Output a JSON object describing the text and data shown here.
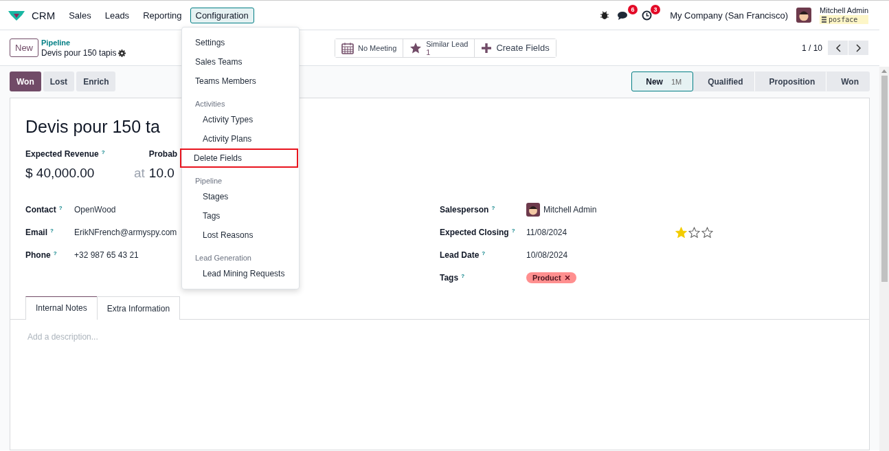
{
  "navbar": {
    "app": "CRM",
    "menus": [
      {
        "label": "Sales",
        "selected": false
      },
      {
        "label": "Leads",
        "selected": false
      },
      {
        "label": "Reporting",
        "selected": false
      },
      {
        "label": "Configuration",
        "selected": true
      }
    ],
    "messages_badge": "6",
    "activities_badge": "3",
    "company": "My Company (San Francisco)",
    "user": "Mitchell Admin",
    "database": "posface"
  },
  "control_panel": {
    "new_button": "New",
    "breadcrumb": "Pipeline",
    "record": "Devis pour 150 tapis",
    "smart_buttons": [
      {
        "kind": "calendar",
        "label": "No Meeting"
      },
      {
        "kind": "star",
        "label": "Similar Lead",
        "count": "1"
      },
      {
        "kind": "plus",
        "label": "Create Fields"
      }
    ],
    "pager": "1 / 10"
  },
  "status_actions": [
    {
      "label": "Won",
      "primary": true
    },
    {
      "label": "Lost",
      "primary": false
    },
    {
      "label": "Enrich",
      "primary": false
    }
  ],
  "stages": [
    {
      "label": "New",
      "badge": "1M",
      "selected": true
    },
    {
      "label": "Qualified",
      "selected": false
    },
    {
      "label": "Proposition",
      "selected": false
    },
    {
      "label": "Won",
      "selected": false
    }
  ],
  "form": {
    "title": "Devis pour 150 ta",
    "revenue_label": "Expected Revenue",
    "help": "?",
    "revenue": "$ 40,000.00",
    "at": "at",
    "probability_label": "Probab",
    "probability": "10.0",
    "left_fields": [
      {
        "label": "Contact",
        "value": "OpenWood"
      },
      {
        "label": "Email",
        "value": "ErikNFrench@armyspy.com"
      },
      {
        "label": "Phone",
        "value": "+32 987 65 43 21"
      }
    ],
    "right_fields": [
      {
        "kind": "user",
        "label": "Salesperson",
        "value": "Mitchell Admin"
      },
      {
        "kind": "text",
        "label": "Expected Closing",
        "value": "11/08/2024",
        "stars": 1
      },
      {
        "kind": "text",
        "label": "Lead Date",
        "value": "10/08/2024"
      },
      {
        "kind": "tag",
        "label": "Tags",
        "value": "Product",
        "color": "#ff8f8f"
      }
    ],
    "tabs": [
      {
        "label": "Internal Notes",
        "selected": true
      },
      {
        "label": "Extra Information",
        "selected": false
      }
    ],
    "description": {
      "placeholder": "Add a description..."
    }
  },
  "dropdown": [
    {
      "kind": "item",
      "label": "Settings",
      "highlighted": false
    },
    {
      "kind": "item",
      "label": "Sales Teams",
      "highlighted": false
    },
    {
      "kind": "item",
      "label": "Teams Members",
      "highlighted": false
    },
    {
      "kind": "header",
      "label": "Activities"
    },
    {
      "kind": "subitem",
      "label": "Activity Types",
      "highlighted": false
    },
    {
      "kind": "subitem",
      "label": "Activity Plans",
      "highlighted": false
    },
    {
      "kind": "item",
      "label": "Delete Fields",
      "highlighted": true
    },
    {
      "kind": "header",
      "label": "Pipeline"
    },
    {
      "kind": "subitem",
      "label": "Stages",
      "highlighted": false
    },
    {
      "kind": "subitem",
      "label": "Tags",
      "highlighted": false
    },
    {
      "kind": "subitem",
      "label": "Lost Reasons",
      "highlighted": false
    },
    {
      "kind": "header",
      "label": "Lead Generation"
    },
    {
      "kind": "subitem",
      "label": "Lead Mining Requests",
      "highlighted": false
    }
  ]
}
